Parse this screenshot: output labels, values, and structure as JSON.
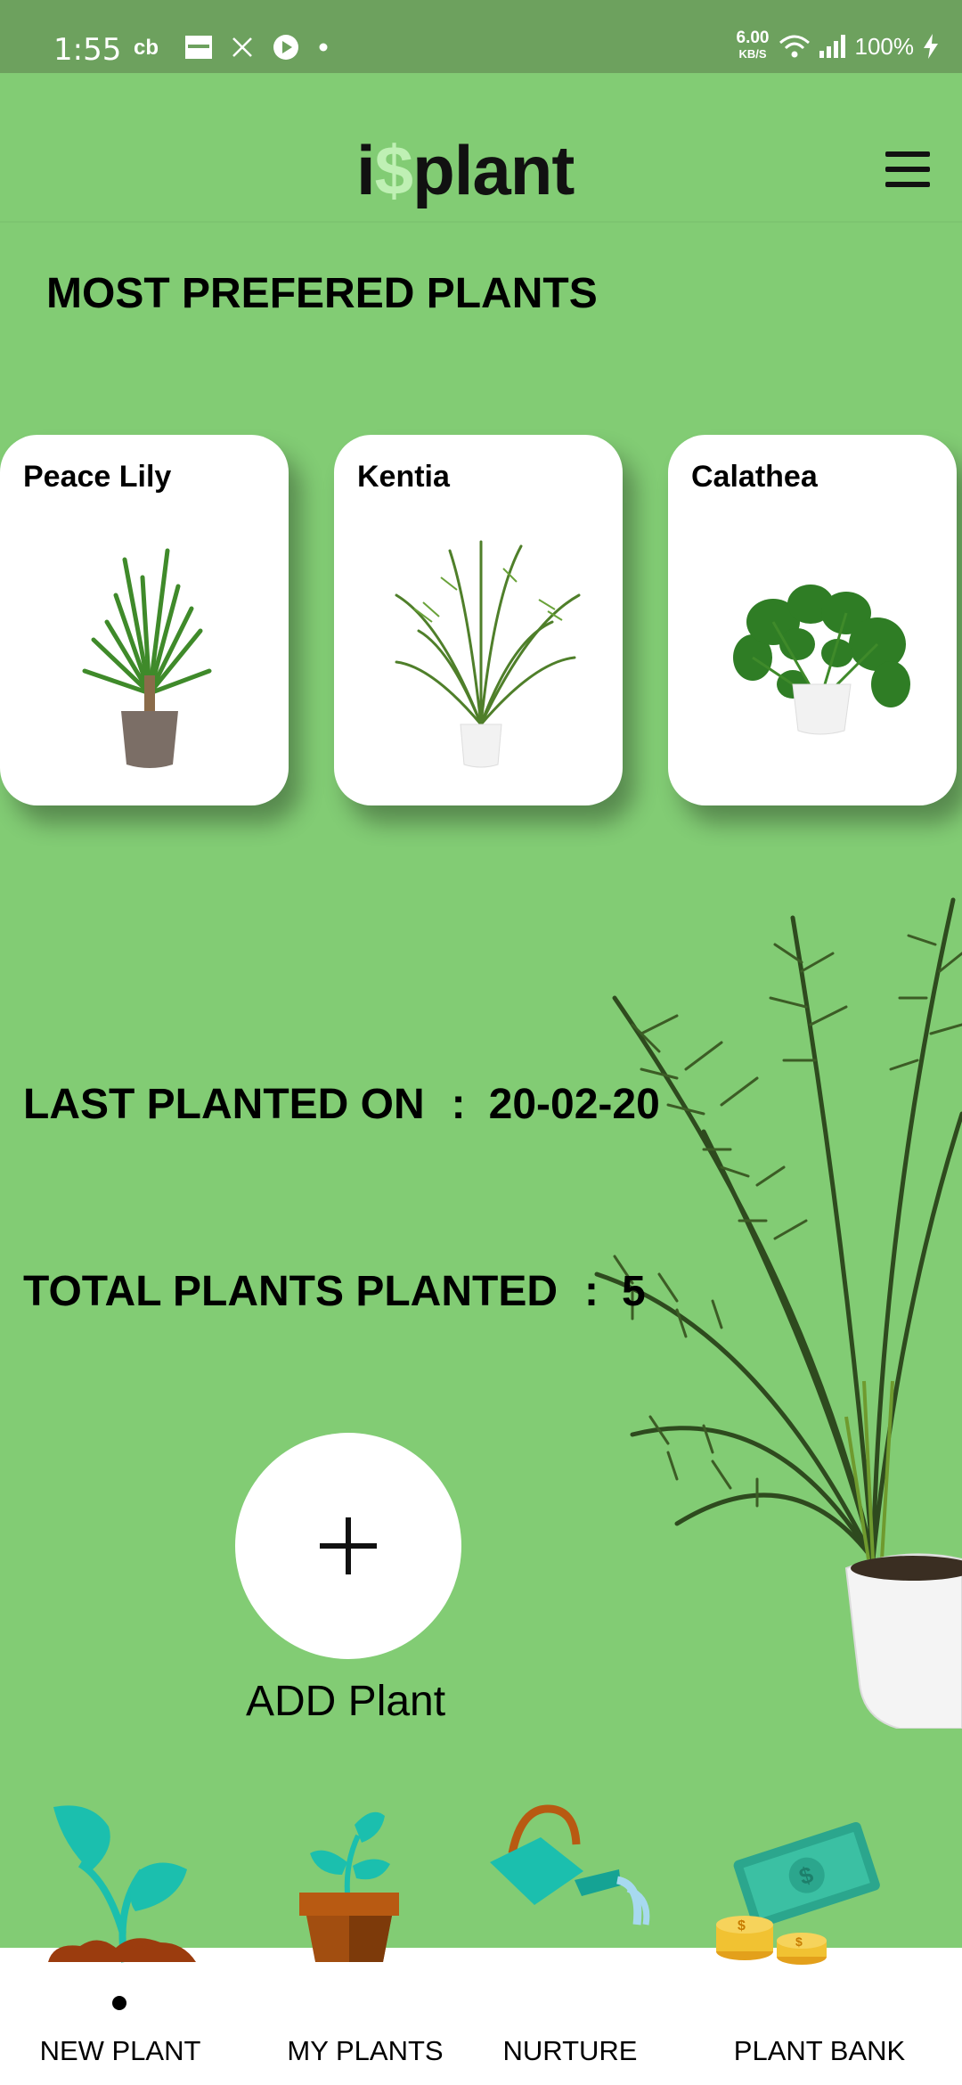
{
  "status_bar": {
    "time": "1:55",
    "speed_value": "6.00",
    "speed_unit": "KB/S",
    "battery": "100%"
  },
  "header": {
    "logo_prefix": "i",
    "logo_symbol": "$",
    "logo_suffix": "plant"
  },
  "section_title": "MOST PREFERED PLANTS",
  "plants": [
    {
      "name": "Peace Lily"
    },
    {
      "name": "Kentia"
    },
    {
      "name": "Calathea"
    }
  ],
  "stats": {
    "last_planted_label": "LAST PLANTED ON",
    "last_planted_sep": ":",
    "last_planted_value": "20-02-20",
    "total_label": "TOTAL PLANTS PLANTED",
    "total_sep": ":",
    "total_value": "5"
  },
  "add_button": {
    "label": "ADD Plant"
  },
  "nav": [
    {
      "label": "NEW PLANT",
      "icon": "sprout-icon",
      "active": true
    },
    {
      "label": "MY PLANTS",
      "icon": "potted-plant-icon",
      "active": false
    },
    {
      "label": "NURTURE",
      "icon": "watering-can-icon",
      "active": false
    },
    {
      "label": "PLANT BANK",
      "icon": "money-icon",
      "active": false
    }
  ],
  "colors": {
    "background": "#82cc74",
    "status_bar": "#6da15e",
    "logo_accent": "#bff0b4"
  }
}
